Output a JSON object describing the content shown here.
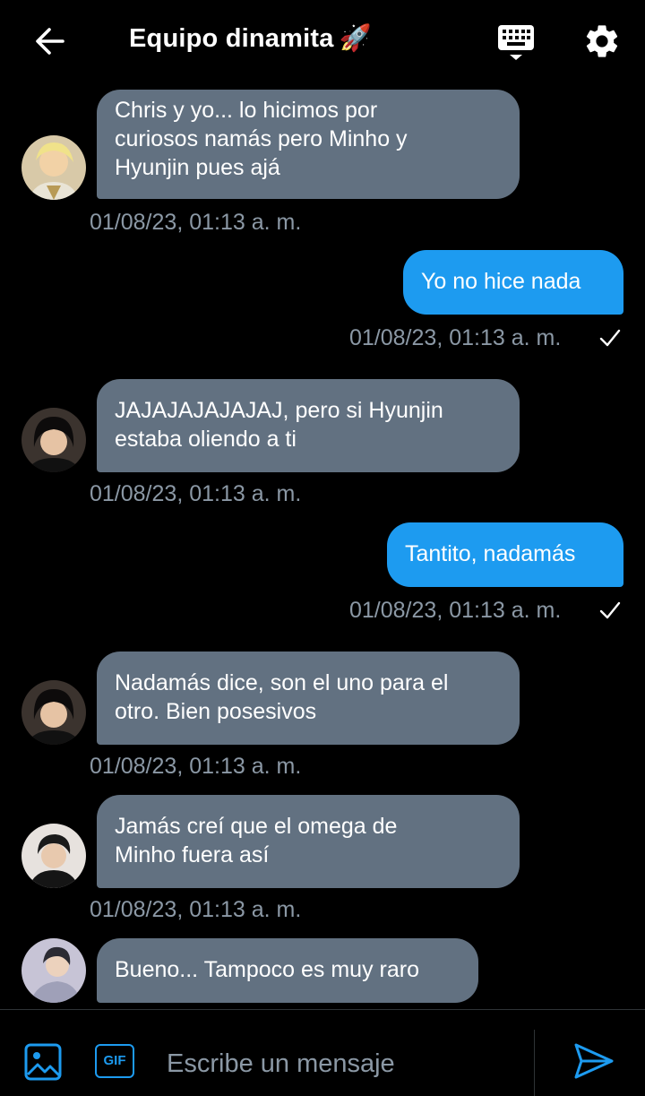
{
  "header": {
    "title": "Equipo dinamita",
    "title_emoji": "🚀",
    "back_icon": "arrow-left-icon",
    "keyboard_icon": "keyboard-icon",
    "settings_icon": "gear-icon"
  },
  "messages": [
    {
      "direction": "in",
      "lines": [
        "Chris y yo... lo hicimos por",
        "curiosos namás pero Minho y",
        "Hyunjin pues ajá"
      ],
      "timestamp": "01/08/23, 01:13 a. m."
    },
    {
      "direction": "out",
      "lines": [
        "Yo no hice nada"
      ],
      "timestamp": "01/08/23, 01:13 a. m."
    },
    {
      "direction": "in",
      "lines": [
        "JAJAJAJAJAJAJ, pero si Hyunjin",
        "estaba oliendo a ti"
      ],
      "timestamp": "01/08/23, 01:13 a. m."
    },
    {
      "direction": "out",
      "lines": [
        "Tantito, nadamás"
      ],
      "timestamp": "01/08/23, 01:13 a. m."
    },
    {
      "direction": "in",
      "lines": [
        "Nadamás dice, son el uno para el",
        "otro. Bien posesivos"
      ],
      "timestamp": "01/08/23, 01:13 a. m."
    },
    {
      "direction": "in",
      "lines": [
        "Jamás creí que el omega de",
        "Minho fuera así"
      ],
      "timestamp": "01/08/23, 01:13 a. m."
    },
    {
      "direction": "in",
      "lines": [
        "Bueno... Tampoco es muy raro"
      ],
      "timestamp": ""
    }
  ],
  "composer": {
    "placeholder": "Escribe un mensaje",
    "gif_label": "GIF",
    "image_icon": "image-icon",
    "send_icon": "send-icon"
  },
  "colors": {
    "background": "#000000",
    "incoming_bubble": "#627181",
    "outgoing_bubble": "#1d9bf0",
    "timestamp": "#8b98a5",
    "accent": "#1d9bf0"
  }
}
